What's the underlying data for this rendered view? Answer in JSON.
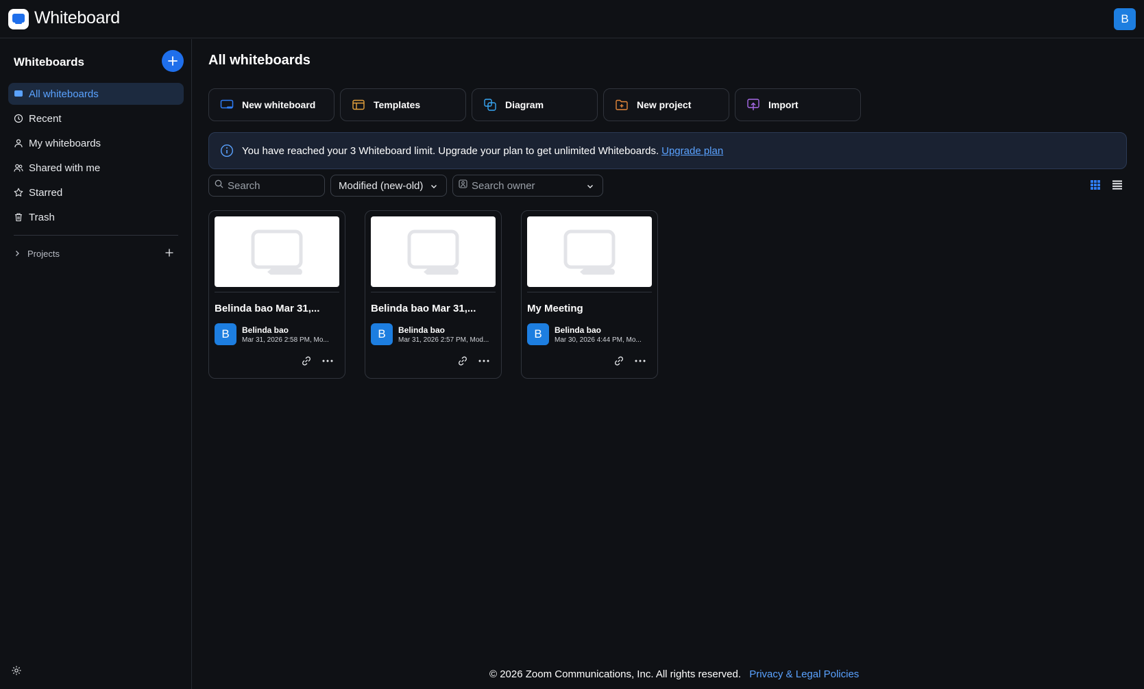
{
  "app": {
    "title": "Whiteboard",
    "user_initial": "B"
  },
  "colors": {
    "accent": "#1f6feb",
    "link": "#5aa2ff",
    "avatar": "#1d7ee0",
    "background": "#0f1115"
  },
  "sidebar": {
    "title": "Whiteboards",
    "items": [
      {
        "label": "All whiteboards",
        "icon": "whiteboard-icon",
        "active": true
      },
      {
        "label": "Recent",
        "icon": "history-icon"
      },
      {
        "label": "My whiteboards",
        "icon": "person-icon"
      },
      {
        "label": "Shared with me",
        "icon": "people-icon"
      },
      {
        "label": "Starred",
        "icon": "star-icon"
      },
      {
        "label": "Trash",
        "icon": "trash-icon"
      }
    ],
    "projects_label": "Projects"
  },
  "main": {
    "title": "All whiteboards",
    "actions": [
      {
        "label": "New whiteboard",
        "icon": "new-whiteboard-icon"
      },
      {
        "label": "Templates",
        "icon": "templates-icon"
      },
      {
        "label": "Diagram",
        "icon": "diagram-icon"
      },
      {
        "label": "New project",
        "icon": "new-project-icon"
      },
      {
        "label": "Import",
        "icon": "import-icon"
      }
    ],
    "banner": {
      "text": "You have reached your 3 Whiteboard limit. Upgrade your plan to get unlimited Whiteboards.",
      "link": "Upgrade plan"
    },
    "filters": {
      "search_placeholder": "Search",
      "sort_value": "Modified (new-old)",
      "owner_placeholder": "Search owner"
    },
    "cards": [
      {
        "title": "Belinda bao Mar 31,...",
        "owner": "Belinda bao",
        "owner_initial": "B",
        "date": "Mar 31, 2026 2:58 PM, Mo..."
      },
      {
        "title": "Belinda bao Mar 31,...",
        "owner": "Belinda bao",
        "owner_initial": "B",
        "date": "Mar 31, 2026 2:57 PM, Mod..."
      },
      {
        "title": "My Meeting",
        "owner": "Belinda bao",
        "owner_initial": "B",
        "date": "Mar 30, 2026 4:44 PM, Mo..."
      }
    ]
  },
  "footer": {
    "copyright": "© 2026 Zoom Communications, Inc. All rights reserved.",
    "privacy": "Privacy & Legal Policies"
  }
}
